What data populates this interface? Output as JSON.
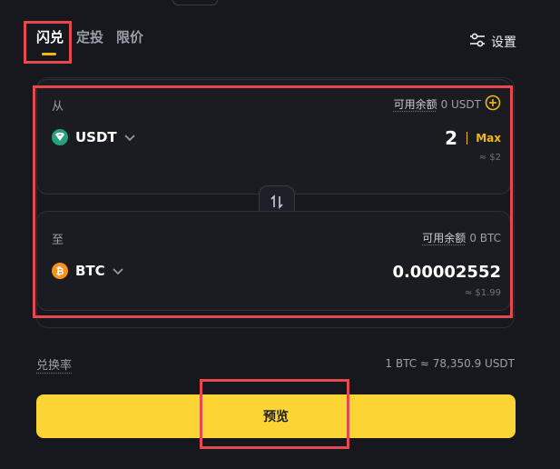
{
  "tabs": [
    {
      "label": "闪兑",
      "active": true
    },
    {
      "label": "定投",
      "active": false
    },
    {
      "label": "限价",
      "active": false
    }
  ],
  "settings": {
    "label": "设置",
    "icon": "sliders-icon"
  },
  "from": {
    "label": "从",
    "balance_label": "可用余额",
    "balance_value": "0 USDT",
    "coin": "USDT",
    "amount": "2",
    "max_label": "Max",
    "approx": "≈ $2",
    "icon_color": "#26a17b"
  },
  "swap": {
    "icon": "swap-arrows-icon"
  },
  "to": {
    "label": "至",
    "balance_label": "可用余额",
    "balance_value": "0 BTC",
    "coin": "BTC",
    "amount": "0.00002552",
    "approx": "≈ $1.99",
    "icon_color": "#f7931a"
  },
  "rate": {
    "label": "兑换率",
    "value": "1 BTC ≈ 78,350.9 USDT"
  },
  "preview_button": "预览",
  "colors": {
    "accent": "#f0b90b",
    "button": "#fcd535",
    "background": "#17181e",
    "highlight": "#e5484d"
  }
}
